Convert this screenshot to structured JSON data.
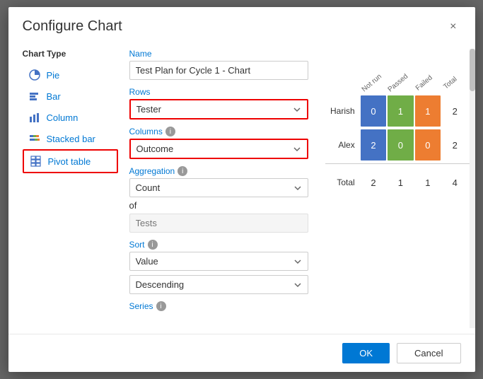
{
  "dialog": {
    "title": "Configure Chart",
    "close_label": "×"
  },
  "sidebar": {
    "label": "Chart Type",
    "items": [
      {
        "id": "pie",
        "label": "Pie",
        "icon": "pie"
      },
      {
        "id": "bar",
        "label": "Bar",
        "icon": "bar"
      },
      {
        "id": "column",
        "label": "Column",
        "icon": "column"
      },
      {
        "id": "stacked-bar",
        "label": "Stacked bar",
        "icon": "stacked-bar"
      },
      {
        "id": "pivot-table",
        "label": "Pivot table",
        "icon": "pivot",
        "selected": true
      }
    ]
  },
  "form": {
    "name_label": "Name",
    "name_value": "Test Plan for Cycle 1 - Chart",
    "rows_label": "Rows",
    "rows_value": "Tester",
    "columns_label": "Columns",
    "columns_value": "Outcome",
    "aggregation_label": "Aggregation",
    "aggregation_value": "Count",
    "of_label": "of",
    "of_placeholder": "Tests",
    "sort_label": "Sort",
    "sort_value": "Value",
    "sort_order_value": "Descending",
    "series_label": "Series"
  },
  "chart": {
    "headers": [
      "Not run",
      "Passed",
      "Failed",
      "Total"
    ],
    "rows": [
      {
        "label": "Harish",
        "cells": [
          {
            "value": "0",
            "type": "blue"
          },
          {
            "value": "1",
            "type": "green"
          },
          {
            "value": "1",
            "type": "orange"
          },
          {
            "value": "2",
            "type": "total"
          }
        ]
      },
      {
        "label": "Alex",
        "cells": [
          {
            "value": "2",
            "type": "blue"
          },
          {
            "value": "0",
            "type": "green"
          },
          {
            "value": "0",
            "type": "orange"
          },
          {
            "value": "2",
            "type": "total"
          }
        ]
      }
    ],
    "total_row": {
      "label": "Total",
      "cells": [
        "2",
        "1",
        "1",
        "4"
      ]
    }
  },
  "footer": {
    "ok_label": "OK",
    "cancel_label": "Cancel"
  }
}
